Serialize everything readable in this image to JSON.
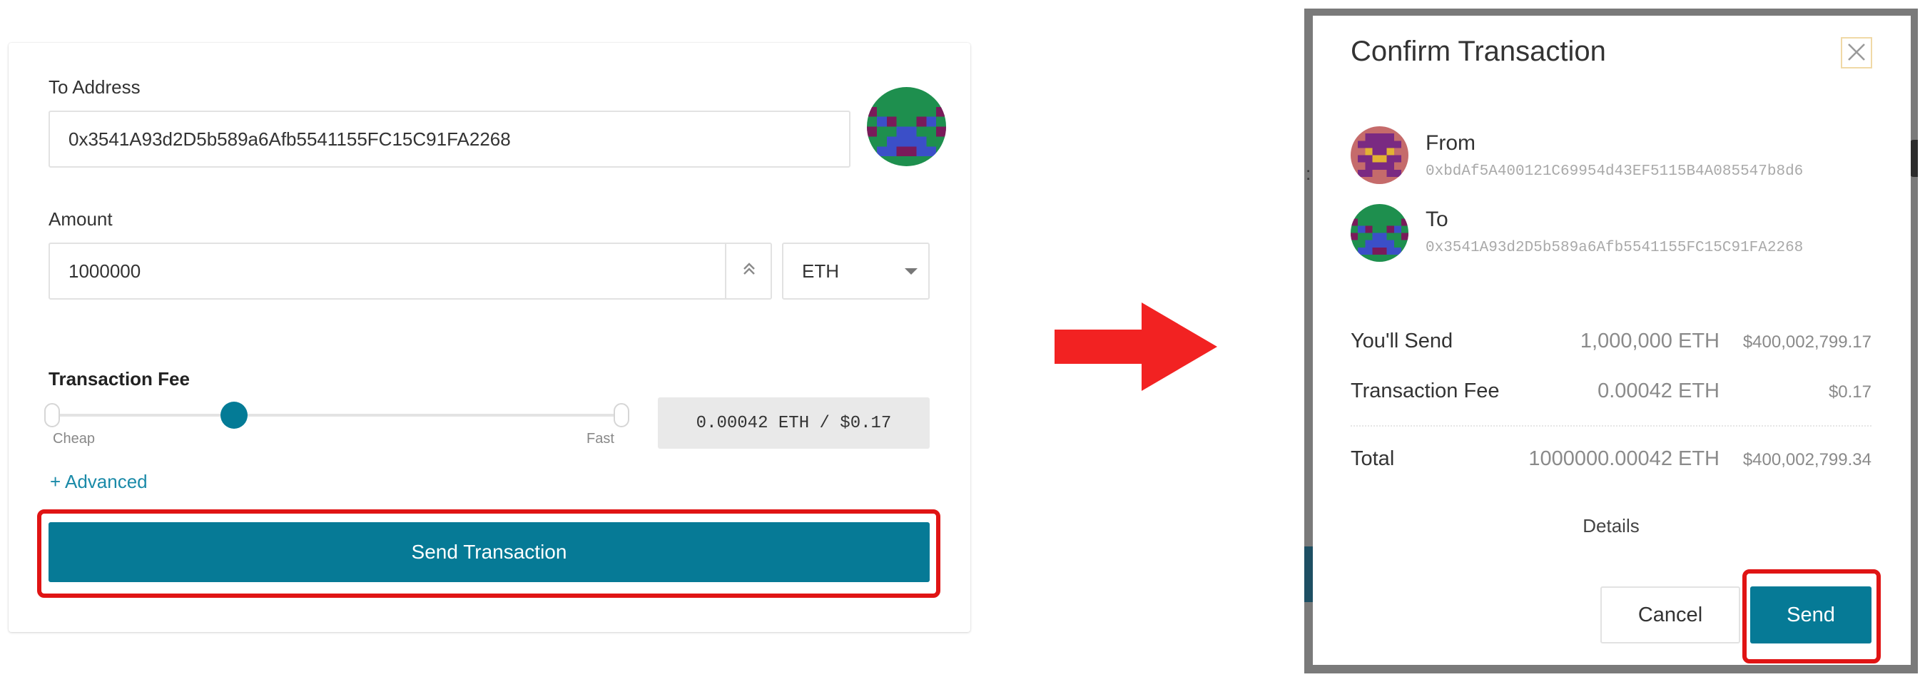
{
  "send_form": {
    "to_address_label": "To Address",
    "to_address_value": "0x3541A93d2D5b589a6Afb5541155FC15C91FA2268",
    "amount_label": "Amount",
    "amount_value": "1000000",
    "unit_selected": "ETH",
    "fee_title": "Transaction Fee",
    "fee_slider_level_percent": 32,
    "slider_cheap_label": "Cheap",
    "slider_fast_label": "Fast",
    "fee_display": "0.00042 ETH / $0.17",
    "advanced_link": "+ Advanced",
    "send_button": "Send Transaction"
  },
  "confirm_modal": {
    "title": "Confirm Transaction",
    "close_icon": "close-icon",
    "from_label": "From",
    "from_address": "0xbdAf5A400121C69954d43EF5115B4A085547b8d6",
    "to_label": "To",
    "to_address": "0x3541A93d2D5b589a6Afb5541155FC15C91FA2268",
    "rows": [
      {
        "label": "You'll Send",
        "value": "1,000,000 ETH",
        "usd": "$400,002,799.17"
      },
      {
        "label": "Transaction Fee",
        "value": "0.00042 ETH",
        "usd": "$0.17"
      },
      {
        "label": "Total",
        "value": "1000000.00042 ETH",
        "usd": "$400,002,799.34"
      }
    ],
    "details_link": "Details",
    "cancel_button": "Cancel",
    "send_button": "Send"
  },
  "colors": {
    "primary": "#067a96",
    "highlight": "#e01414",
    "arrow": "#f22222",
    "modal_backdrop": "#7a7a7a"
  }
}
